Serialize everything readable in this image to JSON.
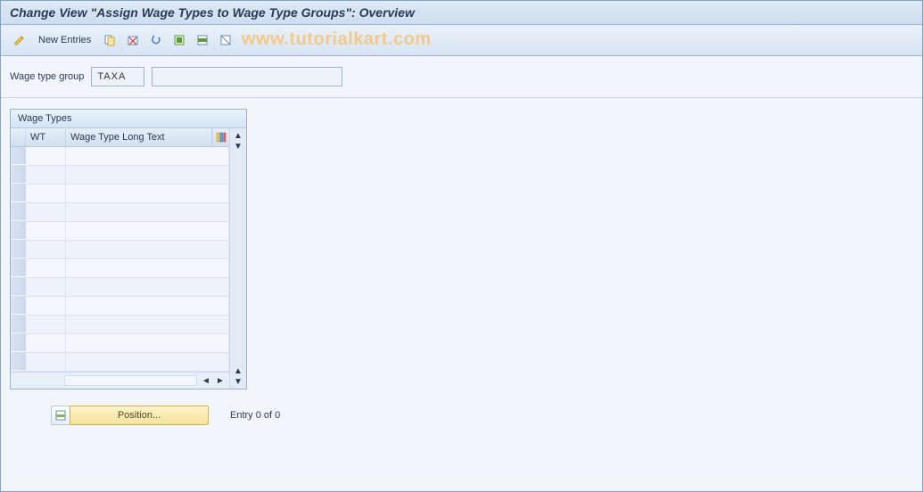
{
  "title": "Change View \"Assign Wage Types to Wage Type Groups\": Overview",
  "toolbar": {
    "new_entries_label": "New Entries",
    "icons": [
      "toggle",
      "copy",
      "delete",
      "undo",
      "select-all",
      "select-block",
      "deselect-all"
    ]
  },
  "watermark": "www.tutorialkart.com",
  "filter": {
    "label": "Wage type group",
    "code": "TAXA",
    "description": ""
  },
  "table": {
    "panel_title": "Wage Types",
    "columns": {
      "wt": "WT",
      "long": "Wage Type Long Text"
    },
    "rows": [
      {
        "wt": "",
        "long": ""
      },
      {
        "wt": "",
        "long": ""
      },
      {
        "wt": "",
        "long": ""
      },
      {
        "wt": "",
        "long": ""
      },
      {
        "wt": "",
        "long": ""
      },
      {
        "wt": "",
        "long": ""
      },
      {
        "wt": "",
        "long": ""
      },
      {
        "wt": "",
        "long": ""
      },
      {
        "wt": "",
        "long": ""
      },
      {
        "wt": "",
        "long": ""
      },
      {
        "wt": "",
        "long": ""
      },
      {
        "wt": "",
        "long": ""
      }
    ]
  },
  "footer": {
    "position_label": "Position...",
    "entry_text": "Entry 0 of 0"
  }
}
